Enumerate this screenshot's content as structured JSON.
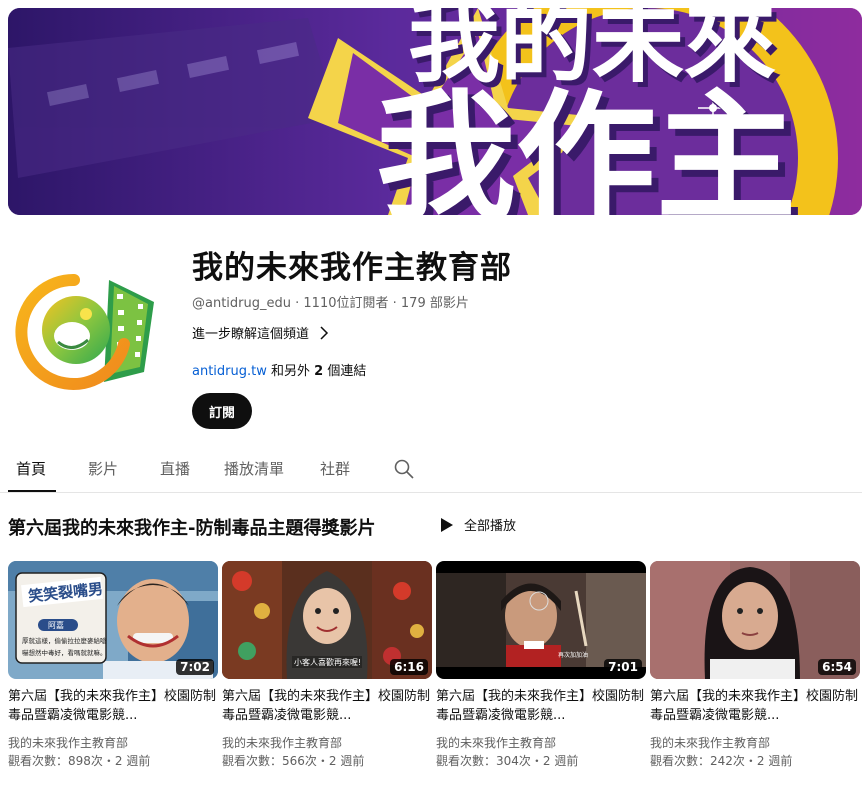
{
  "banner": {
    "line1": "我的未來",
    "line2": "我作主",
    "colors": {
      "bg": "#5a2a9a",
      "gold": "#f3c21b",
      "text": "#ffffff"
    }
  },
  "channel": {
    "title": "我的未來我作主教育部",
    "handle": "@antidrug_edu",
    "subscribers": "1110位訂閱者",
    "video_count": "179 部影片",
    "separator": " · ",
    "more_about": "進一步瞭解這個頻道",
    "link_text": "antidrug.tw",
    "link_suffix": " 和另外 ",
    "link_count": "2",
    "link_suffix2": " 個連結",
    "subscribe_label": "訂閱"
  },
  "tabs": [
    {
      "label": "首頁",
      "active": true
    },
    {
      "label": "影片"
    },
    {
      "label": "直播"
    },
    {
      "label": "播放清單"
    },
    {
      "label": "社群"
    }
  ],
  "section": {
    "title": "第六屆我的未來我作主-防制毒品主題得獎影片",
    "play_all": "全部播放"
  },
  "videos": [
    {
      "title": "第六屆【我的未來我作主】校園防制毒品暨霸凌微電影競...",
      "channel": "我的未來我作主教育部",
      "stats": "觀看次數：898次・2 週前",
      "duration": "7:02",
      "overlay_title": "笑笑裂嘴男",
      "overlay_name": "阿嘉",
      "overlay_text1": "厚就這樣，偷偷拉拉麼麥給嗆",
      "overlay_text2": "嚇想然中毒好，看嗎就就嘛。"
    },
    {
      "title": "第六屆【我的未來我作主】校園防制毒品暨霸凌微電影競...",
      "channel": "我的未來我作主教育部",
      "stats": "觀看次數：566次・2 週前",
      "duration": "6:16",
      "caption": "小客人喜歡再來喔!"
    },
    {
      "title": "第六屆【我的未來我作主】校園防制毒品暨霸凌微電影競...",
      "channel": "我的未來我作主教育部",
      "stats": "觀看次數：304次・2 週前",
      "duration": "7:01",
      "caption": "再次加加油"
    },
    {
      "title": "第六屆【我的未來我作主】校園防制毒品暨霸凌微電影競...",
      "channel": "我的未來我作主教育部",
      "stats": "觀看次數：242次・2 週前",
      "duration": "6:54"
    }
  ]
}
